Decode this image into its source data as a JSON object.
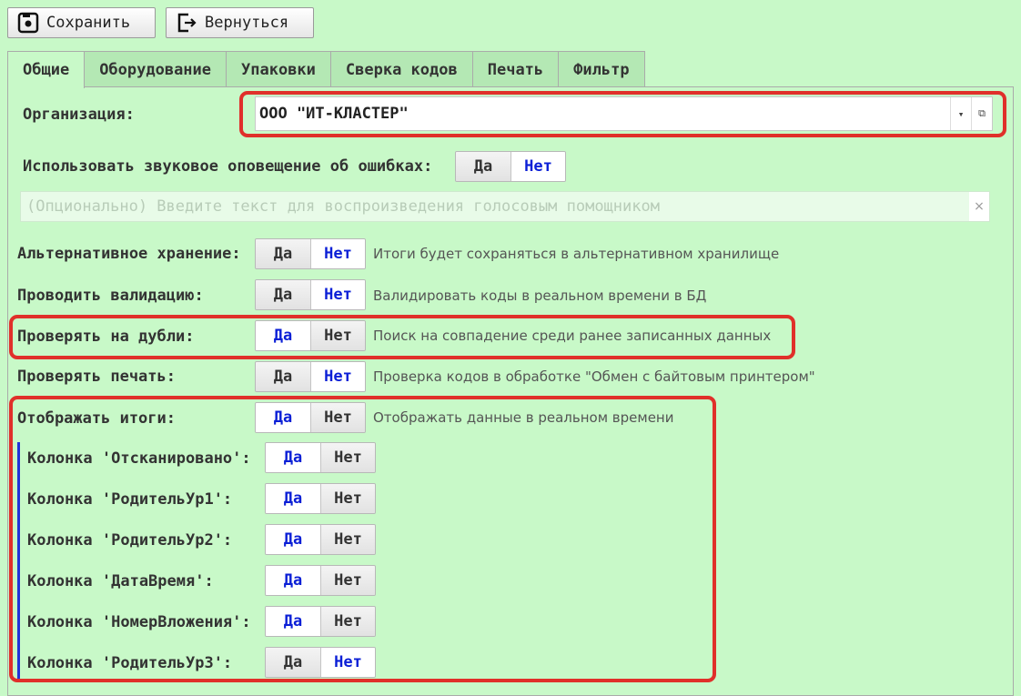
{
  "toolbar": {
    "save_label": "Сохранить",
    "back_label": "Вернуться"
  },
  "tabs": [
    {
      "label": "Общие",
      "active": true
    },
    {
      "label": "Оборудование",
      "active": false
    },
    {
      "label": "Упаковки",
      "active": false
    },
    {
      "label": "Сверка кодов",
      "active": false
    },
    {
      "label": "Печать",
      "active": false
    },
    {
      "label": "Фильтр",
      "active": false
    }
  ],
  "organization": {
    "label": "Организация:",
    "value": "ООО \"ИТ-КЛАСТЕР\""
  },
  "sound": {
    "label": "Использовать звуковое оповещение об ошибках:",
    "selected": "Нет"
  },
  "voice_input": {
    "placeholder": "(Опционально) Введите текст для воспроизведения голосовым помощником"
  },
  "toggle_labels": {
    "yes": "Да",
    "no": "Нет"
  },
  "settings": [
    {
      "label": "Альтернативное хранение:",
      "selected": "Нет",
      "hint": "Итоги будет сохраняться в альтернативном хранилище"
    },
    {
      "label": "Проводить валидацию:",
      "selected": "Нет",
      "hint": "Валидировать коды в реальном времени в БД"
    },
    {
      "label": "Проверять на дубли:",
      "selected": "Да",
      "hint": "Поиск на совпадение среди ранее записанных данных"
    },
    {
      "label": "Проверять печать:",
      "selected": "Нет",
      "hint": "Проверка кодов в обработке \"Обмен с байтовым принтером\""
    },
    {
      "label": "Отображать итоги:",
      "selected": "Да",
      "hint": "Отображать данные в реальном времени"
    }
  ],
  "columns": [
    {
      "label": "Колонка 'Отсканировано':",
      "selected": "Да"
    },
    {
      "label": "Колонка 'РодительУр1':",
      "selected": "Да"
    },
    {
      "label": "Колонка 'РодительУр2':",
      "selected": "Да"
    },
    {
      "label": "Колонка 'ДатаВремя':",
      "selected": "Да"
    },
    {
      "label": "Колонка 'НомерВложения':",
      "selected": "Да"
    },
    {
      "label": "Колонка 'РодительУр3':",
      "selected": "Нет"
    }
  ],
  "colors": {
    "background": "#c8f9c8",
    "selected_text": "#0b1fd6",
    "highlight": "#e0302a"
  }
}
